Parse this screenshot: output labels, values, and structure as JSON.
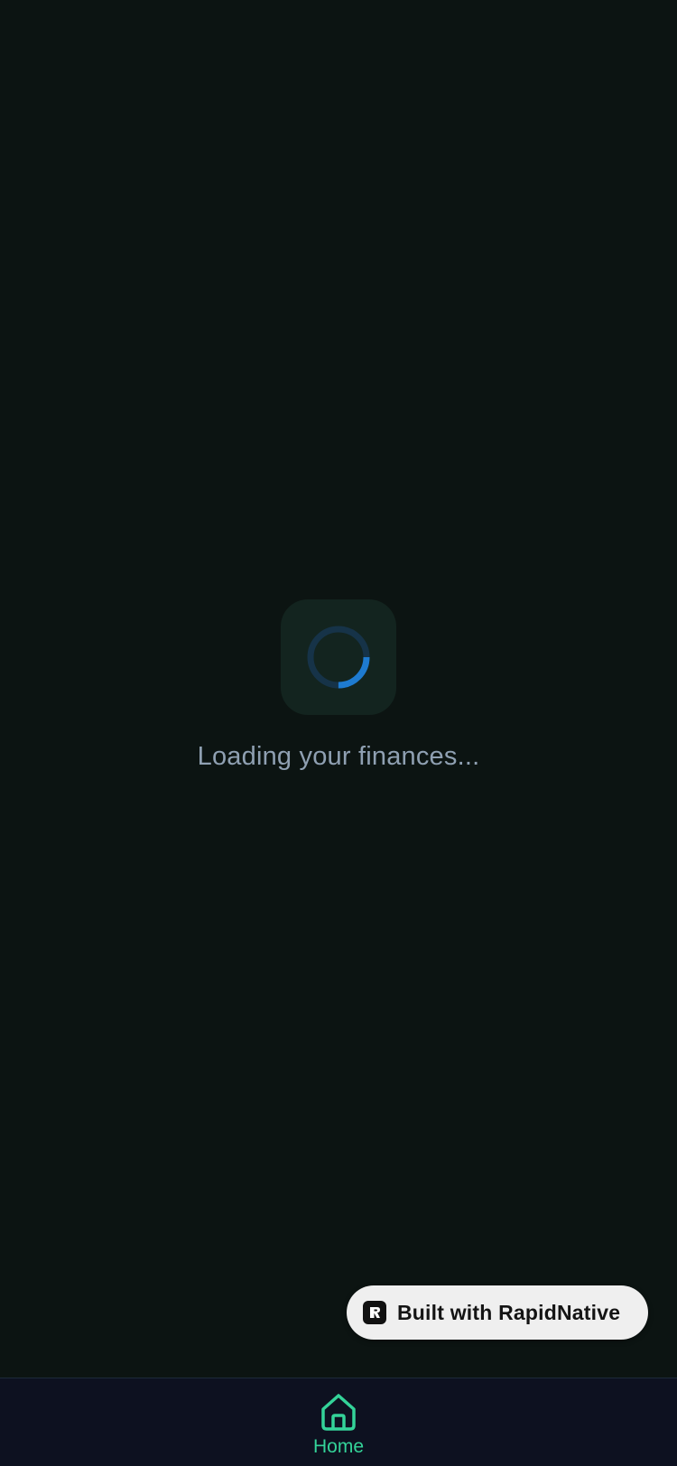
{
  "loading": {
    "message": "Loading your finances...",
    "spinner_icon": "loading-spinner-icon",
    "progress_fraction": 0.25
  },
  "badge": {
    "label": "Built with RapidNative",
    "logo_icon": "rapidnative-logo-icon"
  },
  "tabbar": {
    "tabs": [
      {
        "label": "Home",
        "icon": "home-icon",
        "active": true
      }
    ]
  },
  "colors": {
    "background": "#0c1412",
    "spinner_track": "#163348",
    "spinner_arc": "#1e7bd0",
    "accent": "#34d399",
    "text_muted": "#8fa0b2",
    "tabbar_bg": "#0d1120"
  }
}
